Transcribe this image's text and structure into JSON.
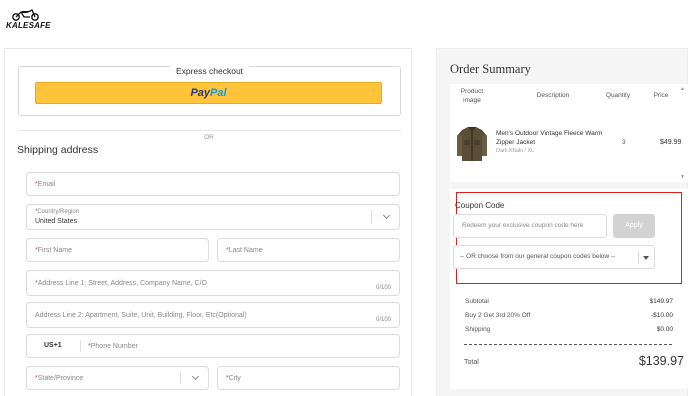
{
  "brand": {
    "name": "KALESAFE"
  },
  "express": {
    "title": "Express checkout",
    "paypal_a": "Pay",
    "paypal_b": "Pal"
  },
  "divider": {
    "or": "OR"
  },
  "shipping": {
    "title": "Shipping address",
    "email_ph": "Email",
    "country_label": "Country/Region",
    "country_value": "United States",
    "first_name_ph": "First Name",
    "last_name_ph": "Last Name",
    "address1_ph": "Address Line 1: Street, Address, Company Name, C/O",
    "address1_count": "0/100",
    "address2_ph": "Address Line 2: Apartment, Suite, Unit, Building, Floor, Etc(Optional)",
    "address2_count": "0/100",
    "phone_code": "US+1",
    "phone_ph": "Phone Number",
    "state_ph": "State/Province",
    "city_ph": "City"
  },
  "summary": {
    "title": "Order Summary",
    "columns": {
      "image": "Product image",
      "description": "Description",
      "quantity": "Quantity",
      "price": "Price"
    },
    "item": {
      "name": "Men's Outdoor Vintage Fleece Warm Zipper Jacket",
      "variant": "Dark Khaki / XL",
      "qty": "3",
      "price": "$49.99"
    }
  },
  "coupon": {
    "title": "Coupon Code",
    "placeholder": "Redeem your exclusive coupon code here",
    "apply": "Apply",
    "select_text": "-- OR choose from our general coupon codes below --"
  },
  "totals": {
    "subtotal_label": "Subtotal",
    "subtotal": "$149.97",
    "discount_label": "Buy 2 Get 3rd 20% Off",
    "discount": "-$10.00",
    "shipping_label": "Shipping",
    "shipping": "$0.00",
    "total_label": "Total",
    "total": "$139.97"
  },
  "colors": {
    "paypal_yellow": "#ffc439",
    "highlight_red": "#e01e1e",
    "required_red": "#e4393c"
  }
}
